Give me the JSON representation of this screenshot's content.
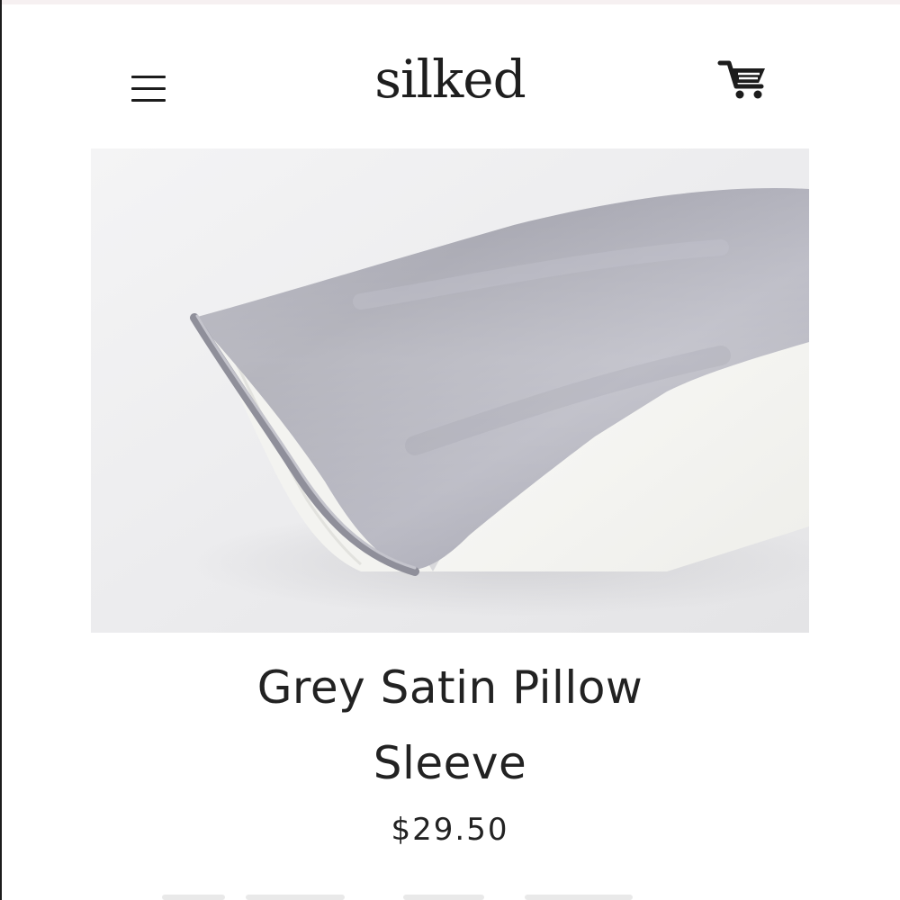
{
  "header": {
    "logo_text": "silked",
    "menu_icon": "hamburger-menu-icon",
    "cart_icon": "shopping-cart-icon"
  },
  "product": {
    "image_subject": "grey satin pillowcase on white pillow",
    "title_line1": "Grey Satin Pillow",
    "title_line2": "Sleeve",
    "price": "$29.50"
  },
  "colors": {
    "text": "#1e1e1e",
    "background": "#ffffff",
    "pillowcase": "#aaaab4",
    "pillow": "#f7f7f5"
  }
}
